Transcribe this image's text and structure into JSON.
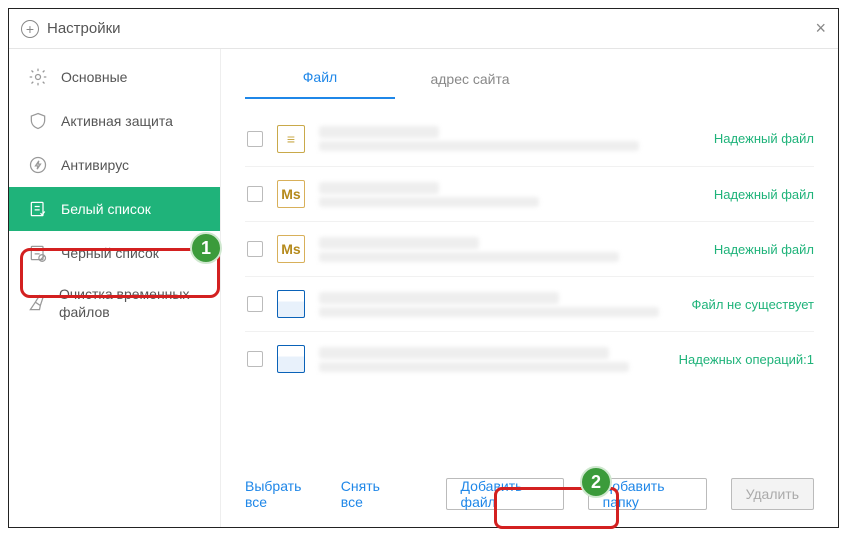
{
  "title": "Настройки",
  "sidebar": {
    "items": [
      {
        "label": "Основные"
      },
      {
        "label": "Активная защита"
      },
      {
        "label": "Антивирус"
      },
      {
        "label": "Белый список"
      },
      {
        "label": "Черный список"
      },
      {
        "label": "Очистка временных файлов"
      }
    ]
  },
  "tabs": {
    "file": "Файл",
    "site": "адрес сайта"
  },
  "rows": [
    {
      "status": "Надежный файл"
    },
    {
      "status": "Надежный файл"
    },
    {
      "status": "Надежный файл"
    },
    {
      "status": "Файл не существует"
    },
    {
      "status": "Надежных операций:1"
    }
  ],
  "footer": {
    "select_all": "Выбрать все",
    "deselect_all": "Снять все",
    "add_file": "Добавить файл",
    "add_folder": "Добавить папку",
    "delete": "Удалить"
  },
  "callouts": {
    "one": "1",
    "two": "2"
  }
}
